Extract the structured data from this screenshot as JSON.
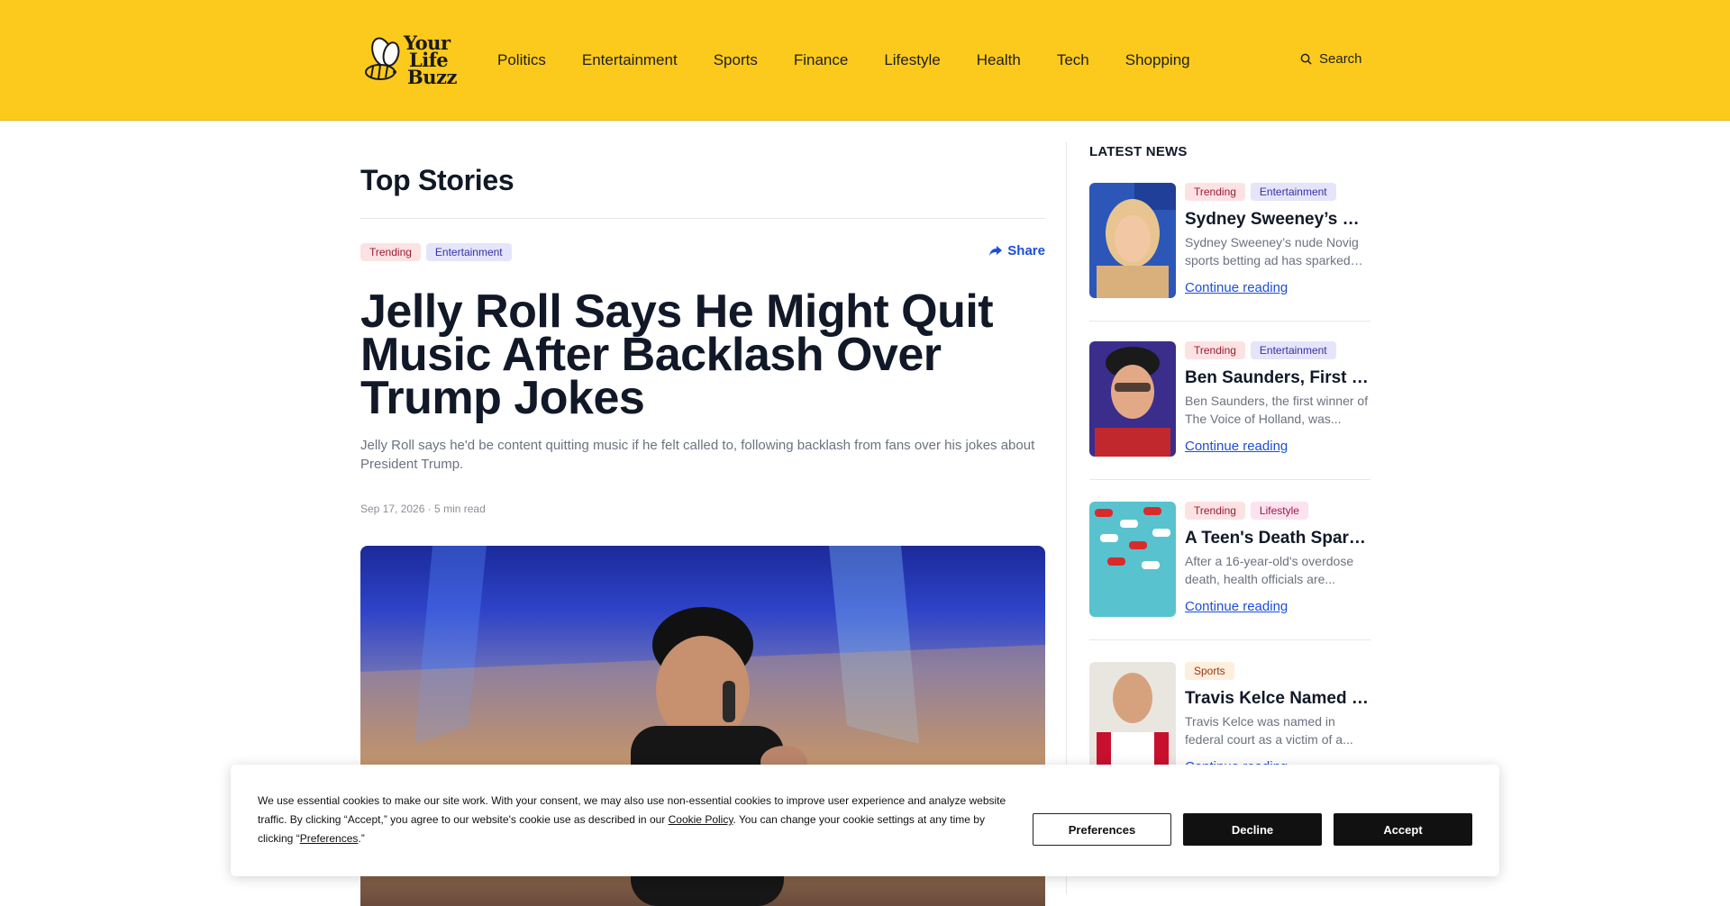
{
  "header": {
    "logo_lines": [
      "Your",
      "Life",
      "Buzz"
    ],
    "nav": [
      "Politics",
      "Entertainment",
      "Sports",
      "Finance",
      "Lifestyle",
      "Health",
      "Tech",
      "Shopping"
    ],
    "search_label": "Search"
  },
  "main": {
    "section_title": "Top Stories",
    "badges": [
      "Trending",
      "Entertainment"
    ],
    "share_label": "Share",
    "headline": "Jelly Roll Says He Might Quit Music After Backlash Over Trump Jokes",
    "dek": "Jelly Roll says he'd be content quitting music if he felt called to, following backlash from fans over his jokes about President Trump.",
    "meta": "Sep 17, 2026 · 5 min read"
  },
  "sidebar": {
    "title": "LATEST NEWS",
    "cards": [
      {
        "badges": [
          "Trending",
          "Entertainment"
        ],
        "title": "Sydney Sweeney’s Nude Novig Ad Sparks Debate",
        "desc": "Sydney Sweeney’s nude Novig sports betting ad has sparked backlash online.",
        "link": "Continue reading"
      },
      {
        "badges": [
          "Trending",
          "Entertainment"
        ],
        "title": "Ben Saunders, First Winner of The Voice",
        "desc": "Ben Saunders, the first winner of The Voice of Holland, was...",
        "link": "Continue reading"
      },
      {
        "badges": [
          "Trending",
          "Lifestyle"
        ],
        "title": "A Teen's Death Sparks Warning",
        "desc": "After a 16-year-old's overdose death, health officials are...",
        "link": "Continue reading"
      },
      {
        "badges": [
          "Sports"
        ],
        "title": "Travis Kelce Named Victim",
        "desc": "Travis Kelce was named in federal court as a victim of a...",
        "link": "Continue reading"
      }
    ]
  },
  "cookie": {
    "text_1": "We use essential cookies to make our site work. With your consent, we may also use non-essential cookies to improve user experience and analyze website traffic. By clicking “Accept,” you agree to our website's cookie use as described in our ",
    "policy_link": "Cookie Policy",
    "text_2": ". You can change your cookie settings at any time by clicking “",
    "pref_link": "Preferences",
    "text_3": ".”",
    "btn_preferences": "Preferences",
    "btn_decline": "Decline",
    "btn_accept": "Accept"
  },
  "colors": {
    "header_bg": "#fbca1c",
    "link": "#1d4ed8"
  }
}
